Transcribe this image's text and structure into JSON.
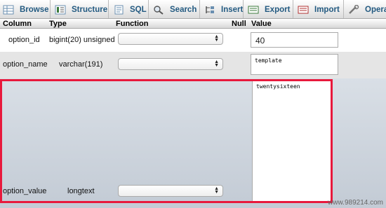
{
  "tabs": [
    {
      "label": "Browse",
      "icon": "browse-icon"
    },
    {
      "label": "Structure",
      "icon": "structure-icon"
    },
    {
      "label": "SQL",
      "icon": "sql-icon"
    },
    {
      "label": "Search",
      "icon": "search-icon"
    },
    {
      "label": "Insert",
      "icon": "insert-icon"
    },
    {
      "label": "Export",
      "icon": "export-icon"
    },
    {
      "label": "Import",
      "icon": "import-icon"
    },
    {
      "label": "Opera",
      "icon": "operations-icon"
    }
  ],
  "table": {
    "headers": {
      "column": "Column",
      "type": "Type",
      "function": "Function",
      "null": "Null",
      "value": "Value"
    },
    "rows": [
      {
        "column": "option_id",
        "type": "bigint(20) unsigned",
        "value": "40"
      },
      {
        "column": "option_name",
        "type": "varchar(191)",
        "value": "template"
      },
      {
        "column": "option_value",
        "type": "longtext",
        "value": "twentysixteen"
      }
    ]
  },
  "highlight_color": "#e8193c",
  "accent_color": "#235a81",
  "watermark": "www.989214.com"
}
